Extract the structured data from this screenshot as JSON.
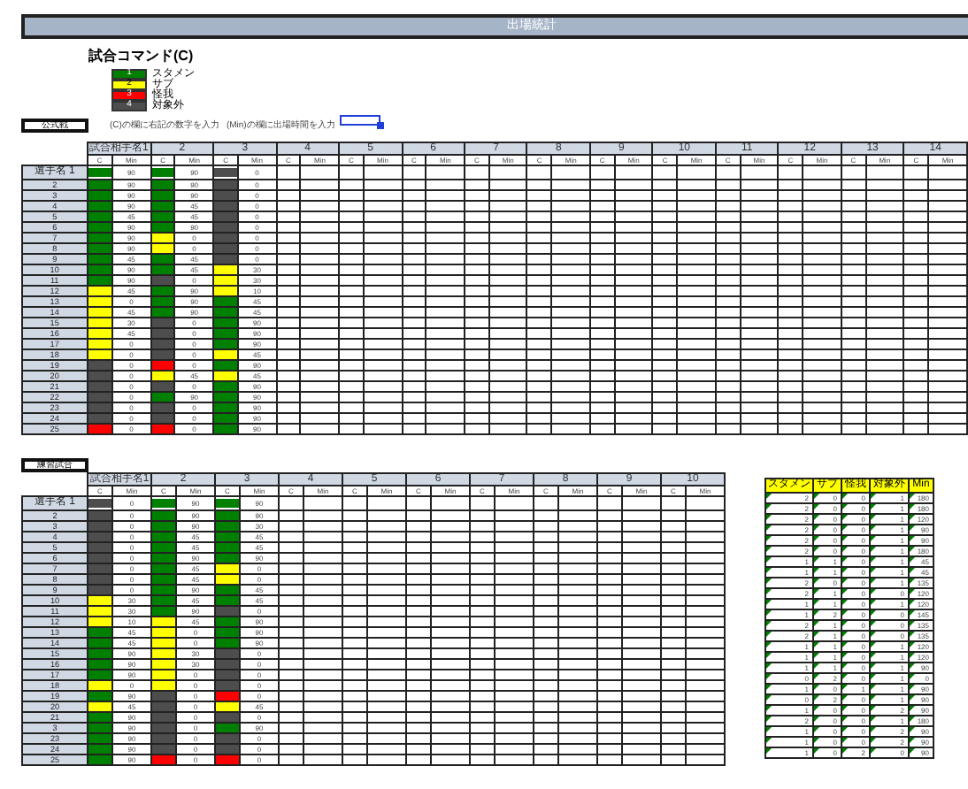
{
  "title": "出場統計",
  "command": {
    "heading": "試合コマンド(C)",
    "legend": [
      {
        "code": "1",
        "label": "スタメン",
        "kind": "starter"
      },
      {
        "code": "2",
        "label": "サブ",
        "kind": "sub"
      },
      {
        "code": "3",
        "label": "怪我",
        "kind": "injured"
      },
      {
        "code": "4",
        "label": "対象外",
        "kind": "excluded"
      }
    ]
  },
  "official": {
    "label": "公式戦",
    "notes": [
      "(C)の欄に右記の数字を入力",
      "(Min)の欄に出場時間を入力"
    ],
    "games": [
      {
        "name": "試合相手名1",
        "c": "C",
        "min": "Min"
      },
      {
        "name": "2",
        "c": "C",
        "min": "Min"
      },
      {
        "name": "3",
        "c": "C",
        "min": "Min"
      },
      {
        "name": "4",
        "c": "C",
        "min": "Min"
      },
      {
        "name": "5",
        "c": "C",
        "min": "Min"
      },
      {
        "name": "6",
        "c": "C",
        "min": "Min"
      },
      {
        "name": "7",
        "c": "C",
        "min": "Min"
      },
      {
        "name": "8",
        "c": "C",
        "min": "Min"
      },
      {
        "name": "9",
        "c": "C",
        "min": "Min"
      },
      {
        "name": "10",
        "c": "C",
        "min": "Min"
      },
      {
        "name": "11",
        "c": "C",
        "min": "Min"
      },
      {
        "name": "12",
        "c": "C",
        "min": "Min"
      },
      {
        "name": "13",
        "c": "C",
        "min": "Min"
      },
      {
        "name": "14",
        "c": "C",
        "min": "Min"
      }
    ],
    "rows": [
      {
        "label": "選手名 1",
        "cells": [
          {
            "kind": "starter",
            "min": "90"
          },
          {
            "kind": "starter",
            "min": "90"
          },
          {
            "kind": "excluded",
            "min": "0"
          }
        ]
      },
      {
        "label": "2",
        "cells": [
          {
            "kind": "starter",
            "min": "90"
          },
          {
            "kind": "starter",
            "min": "90"
          },
          {
            "kind": "excluded",
            "min": "0"
          }
        ]
      },
      {
        "label": "3",
        "cells": [
          {
            "kind": "starter",
            "min": "90"
          },
          {
            "kind": "starter",
            "min": "90"
          },
          {
            "kind": "excluded",
            "min": "0"
          }
        ]
      },
      {
        "label": "4",
        "cells": [
          {
            "kind": "starter",
            "min": "90"
          },
          {
            "kind": "starter",
            "min": "45"
          },
          {
            "kind": "excluded",
            "min": "0"
          }
        ]
      },
      {
        "label": "5",
        "cells": [
          {
            "kind": "starter",
            "min": "45"
          },
          {
            "kind": "starter",
            "min": "45"
          },
          {
            "kind": "excluded",
            "min": "0"
          }
        ]
      },
      {
        "label": "6",
        "cells": [
          {
            "kind": "starter",
            "min": "90"
          },
          {
            "kind": "starter",
            "min": "90"
          },
          {
            "kind": "excluded",
            "min": "0"
          }
        ]
      },
      {
        "label": "7",
        "cells": [
          {
            "kind": "starter",
            "min": "90"
          },
          {
            "kind": "sub",
            "min": "0"
          },
          {
            "kind": "excluded",
            "min": "0"
          }
        ]
      },
      {
        "label": "8",
        "cells": [
          {
            "kind": "starter",
            "min": "90"
          },
          {
            "kind": "sub",
            "min": "0"
          },
          {
            "kind": "excluded",
            "min": "0"
          }
        ]
      },
      {
        "label": "9",
        "cells": [
          {
            "kind": "starter",
            "min": "45"
          },
          {
            "kind": "starter",
            "min": "45"
          },
          {
            "kind": "excluded",
            "min": "0"
          }
        ]
      },
      {
        "label": "10",
        "cells": [
          {
            "kind": "starter",
            "min": "90"
          },
          {
            "kind": "starter",
            "min": "45"
          },
          {
            "kind": "sub",
            "min": "30"
          }
        ]
      },
      {
        "label": "11",
        "cells": [
          {
            "kind": "starter",
            "min": "90"
          },
          {
            "kind": "excluded",
            "min": "0"
          },
          {
            "kind": "sub",
            "min": "30"
          }
        ]
      },
      {
        "label": "12",
        "cells": [
          {
            "kind": "sub",
            "min": "45"
          },
          {
            "kind": "starter",
            "min": "90"
          },
          {
            "kind": "sub",
            "min": "10"
          }
        ]
      },
      {
        "label": "13",
        "cells": [
          {
            "kind": "sub",
            "min": "0"
          },
          {
            "kind": "starter",
            "min": "90"
          },
          {
            "kind": "starter",
            "min": "45"
          }
        ]
      },
      {
        "label": "14",
        "cells": [
          {
            "kind": "sub",
            "min": "45"
          },
          {
            "kind": "starter",
            "min": "90"
          },
          {
            "kind": "starter",
            "min": "45"
          }
        ]
      },
      {
        "label": "15",
        "cells": [
          {
            "kind": "sub",
            "min": "30"
          },
          {
            "kind": "excluded",
            "min": "0"
          },
          {
            "kind": "starter",
            "min": "90"
          }
        ]
      },
      {
        "label": "16",
        "cells": [
          {
            "kind": "sub",
            "min": "45"
          },
          {
            "kind": "excluded",
            "min": "0"
          },
          {
            "kind": "starter",
            "min": "90"
          }
        ]
      },
      {
        "label": "17",
        "cells": [
          {
            "kind": "sub",
            "min": "0"
          },
          {
            "kind": "excluded",
            "min": "0"
          },
          {
            "kind": "starter",
            "min": "90"
          }
        ]
      },
      {
        "label": "18",
        "cells": [
          {
            "kind": "sub",
            "min": "0"
          },
          {
            "kind": "excluded",
            "min": "0"
          },
          {
            "kind": "sub",
            "min": "45"
          }
        ]
      },
      {
        "label": "19",
        "cells": [
          {
            "kind": "excluded",
            "min": "0"
          },
          {
            "kind": "injured",
            "min": "0"
          },
          {
            "kind": "starter",
            "min": "90"
          }
        ]
      },
      {
        "label": "20",
        "cells": [
          {
            "kind": "excluded",
            "min": "0"
          },
          {
            "kind": "sub",
            "min": "45"
          },
          {
            "kind": "sub",
            "min": "45"
          }
        ]
      },
      {
        "label": "21",
        "cells": [
          {
            "kind": "excluded",
            "min": "0"
          },
          {
            "kind": "excluded",
            "min": "0"
          },
          {
            "kind": "starter",
            "min": "90"
          }
        ]
      },
      {
        "label": "22",
        "cells": [
          {
            "kind": "excluded",
            "min": "0"
          },
          {
            "kind": "starter",
            "min": "90"
          },
          {
            "kind": "starter",
            "min": "90"
          }
        ]
      },
      {
        "label": "23",
        "cells": [
          {
            "kind": "excluded",
            "min": "0"
          },
          {
            "kind": "excluded",
            "min": "0"
          },
          {
            "kind": "starter",
            "min": "90"
          }
        ]
      },
      {
        "label": "24",
        "cells": [
          {
            "kind": "excluded",
            "min": "0"
          },
          {
            "kind": "excluded",
            "min": "0"
          },
          {
            "kind": "starter",
            "min": "90"
          }
        ]
      },
      {
        "label": "25",
        "cells": [
          {
            "kind": "injured",
            "min": "0"
          },
          {
            "kind": "injured",
            "min": "0"
          },
          {
            "kind": "starter",
            "min": "90"
          }
        ]
      }
    ]
  },
  "practice": {
    "label": "練習試合",
    "games": [
      {
        "name": "試合相手名1",
        "c": "C",
        "min": "Min"
      },
      {
        "name": "2",
        "c": "C",
        "min": "Min"
      },
      {
        "name": "3",
        "c": "C",
        "min": "Min"
      },
      {
        "name": "4",
        "c": "C",
        "min": "Min"
      },
      {
        "name": "5",
        "c": "C",
        "min": "Min"
      },
      {
        "name": "6",
        "c": "C",
        "min": "Min"
      },
      {
        "name": "7",
        "c": "C",
        "min": "Min"
      },
      {
        "name": "8",
        "c": "C",
        "min": "Min"
      },
      {
        "name": "9",
        "c": "C",
        "min": "Min"
      },
      {
        "name": "10",
        "c": "C",
        "min": "Min"
      }
    ],
    "rows": [
      {
        "label": "選手名 1",
        "cells": [
          {
            "kind": "excluded",
            "min": "0"
          },
          {
            "kind": "starter",
            "min": "90"
          },
          {
            "kind": "starter",
            "min": "90"
          }
        ]
      },
      {
        "label": "2",
        "cells": [
          {
            "kind": "excluded",
            "min": "0"
          },
          {
            "kind": "starter",
            "min": "90"
          },
          {
            "kind": "starter",
            "min": "90"
          }
        ]
      },
      {
        "label": "3",
        "cells": [
          {
            "kind": "excluded",
            "min": "0"
          },
          {
            "kind": "starter",
            "min": "90"
          },
          {
            "kind": "starter",
            "min": "30"
          }
        ]
      },
      {
        "label": "4",
        "cells": [
          {
            "kind": "excluded",
            "min": "0"
          },
          {
            "kind": "starter",
            "min": "45"
          },
          {
            "kind": "starter",
            "min": "45"
          }
        ]
      },
      {
        "label": "5",
        "cells": [
          {
            "kind": "excluded",
            "min": "0"
          },
          {
            "kind": "starter",
            "min": "45"
          },
          {
            "kind": "starter",
            "min": "45"
          }
        ]
      },
      {
        "label": "6",
        "cells": [
          {
            "kind": "excluded",
            "min": "0"
          },
          {
            "kind": "starter",
            "min": "90"
          },
          {
            "kind": "starter",
            "min": "90"
          }
        ]
      },
      {
        "label": "7",
        "cells": [
          {
            "kind": "excluded",
            "min": "0"
          },
          {
            "kind": "starter",
            "min": "45"
          },
          {
            "kind": "sub",
            "min": "0"
          }
        ]
      },
      {
        "label": "8",
        "cells": [
          {
            "kind": "excluded",
            "min": "0"
          },
          {
            "kind": "starter",
            "min": "45"
          },
          {
            "kind": "sub",
            "min": "0"
          }
        ]
      },
      {
        "label": "9",
        "cells": [
          {
            "kind": "excluded",
            "min": "0"
          },
          {
            "kind": "starter",
            "min": "90"
          },
          {
            "kind": "starter",
            "min": "45"
          }
        ]
      },
      {
        "label": "10",
        "cells": [
          {
            "kind": "sub",
            "min": "30"
          },
          {
            "kind": "starter",
            "min": "45"
          },
          {
            "kind": "starter",
            "min": "45"
          }
        ]
      },
      {
        "label": "11",
        "cells": [
          {
            "kind": "sub",
            "min": "30"
          },
          {
            "kind": "starter",
            "min": "90"
          },
          {
            "kind": "excluded",
            "min": "0"
          }
        ]
      },
      {
        "label": "12",
        "cells": [
          {
            "kind": "sub",
            "min": "10"
          },
          {
            "kind": "sub",
            "min": "45"
          },
          {
            "kind": "starter",
            "min": "90"
          }
        ]
      },
      {
        "label": "13",
        "cells": [
          {
            "kind": "starter",
            "min": "45"
          },
          {
            "kind": "sub",
            "min": "0"
          },
          {
            "kind": "starter",
            "min": "90"
          }
        ]
      },
      {
        "label": "14",
        "cells": [
          {
            "kind": "starter",
            "min": "45"
          },
          {
            "kind": "sub",
            "min": "0"
          },
          {
            "kind": "starter",
            "min": "90"
          }
        ]
      },
      {
        "label": "15",
        "cells": [
          {
            "kind": "starter",
            "min": "90"
          },
          {
            "kind": "sub",
            "min": "30"
          },
          {
            "kind": "excluded",
            "min": "0"
          }
        ]
      },
      {
        "label": "16",
        "cells": [
          {
            "kind": "starter",
            "min": "90"
          },
          {
            "kind": "sub",
            "min": "30"
          },
          {
            "kind": "excluded",
            "min": "0"
          }
        ]
      },
      {
        "label": "17",
        "cells": [
          {
            "kind": "starter",
            "min": "90"
          },
          {
            "kind": "sub",
            "min": "0"
          },
          {
            "kind": "excluded",
            "min": "0"
          }
        ]
      },
      {
        "label": "18",
        "cells": [
          {
            "kind": "sub",
            "min": "0"
          },
          {
            "kind": "sub",
            "min": "0"
          },
          {
            "kind": "excluded",
            "min": "0"
          }
        ]
      },
      {
        "label": "19",
        "cells": [
          {
            "kind": "starter",
            "min": "90"
          },
          {
            "kind": "excluded",
            "min": "0"
          },
          {
            "kind": "injured",
            "min": "0"
          }
        ]
      },
      {
        "label": "20",
        "cells": [
          {
            "kind": "sub",
            "min": "45"
          },
          {
            "kind": "excluded",
            "min": "0"
          },
          {
            "kind": "sub",
            "min": "45"
          }
        ]
      },
      {
        "label": "21",
        "cells": [
          {
            "kind": "starter",
            "min": "90"
          },
          {
            "kind": "excluded",
            "min": "0"
          },
          {
            "kind": "excluded",
            "min": "0"
          }
        ]
      },
      {
        "label": "3",
        "cells": [
          {
            "kind": "starter",
            "min": "90"
          },
          {
            "kind": "excluded",
            "min": "0"
          },
          {
            "kind": "starter",
            "min": "90"
          }
        ]
      },
      {
        "label": "23",
        "cells": [
          {
            "kind": "starter",
            "min": "90"
          },
          {
            "kind": "excluded",
            "min": "0"
          },
          {
            "kind": "excluded",
            "min": "0"
          }
        ]
      },
      {
        "label": "24",
        "cells": [
          {
            "kind": "starter",
            "min": "90"
          },
          {
            "kind": "excluded",
            "min": "0"
          },
          {
            "kind": "excluded",
            "min": "0"
          }
        ]
      },
      {
        "label": "25",
        "cells": [
          {
            "kind": "starter",
            "min": "90"
          },
          {
            "kind": "injured",
            "min": "0"
          },
          {
            "kind": "injured",
            "min": "0"
          }
        ]
      }
    ]
  },
  "summary": {
    "columns": [
      "スタメン",
      "サブ",
      "怪我",
      "対象外",
      "Min"
    ],
    "rows": [
      [
        "2",
        "0",
        "0",
        "1",
        "180"
      ],
      [
        "2",
        "0",
        "0",
        "1",
        "180"
      ],
      [
        "2",
        "0",
        "0",
        "1",
        "120"
      ],
      [
        "2",
        "0",
        "0",
        "1",
        "90"
      ],
      [
        "2",
        "0",
        "0",
        "1",
        "90"
      ],
      [
        "2",
        "0",
        "0",
        "1",
        "180"
      ],
      [
        "1",
        "1",
        "0",
        "1",
        "45"
      ],
      [
        "1",
        "1",
        "0",
        "1",
        "45"
      ],
      [
        "2",
        "0",
        "0",
        "1",
        "135"
      ],
      [
        "2",
        "1",
        "0",
        "0",
        "120"
      ],
      [
        "1",
        "1",
        "0",
        "1",
        "120"
      ],
      [
        "1",
        "2",
        "0",
        "0",
        "145"
      ],
      [
        "2",
        "1",
        "0",
        "0",
        "135"
      ],
      [
        "2",
        "1",
        "0",
        "0",
        "135"
      ],
      [
        "1",
        "1",
        "0",
        "1",
        "120"
      ],
      [
        "1",
        "1",
        "0",
        "1",
        "120"
      ],
      [
        "1",
        "1",
        "0",
        "1",
        "90"
      ],
      [
        "0",
        "2",
        "0",
        "1",
        "0"
      ],
      [
        "1",
        "0",
        "1",
        "1",
        "90"
      ],
      [
        "0",
        "2",
        "0",
        "1",
        "90"
      ],
      [
        "1",
        "0",
        "0",
        "2",
        "90"
      ],
      [
        "2",
        "0",
        "0",
        "1",
        "180"
      ],
      [
        "1",
        "0",
        "0",
        "2",
        "90"
      ],
      [
        "1",
        "0",
        "0",
        "2",
        "90"
      ],
      [
        "1",
        "0",
        "2",
        "0",
        "90"
      ]
    ]
  }
}
